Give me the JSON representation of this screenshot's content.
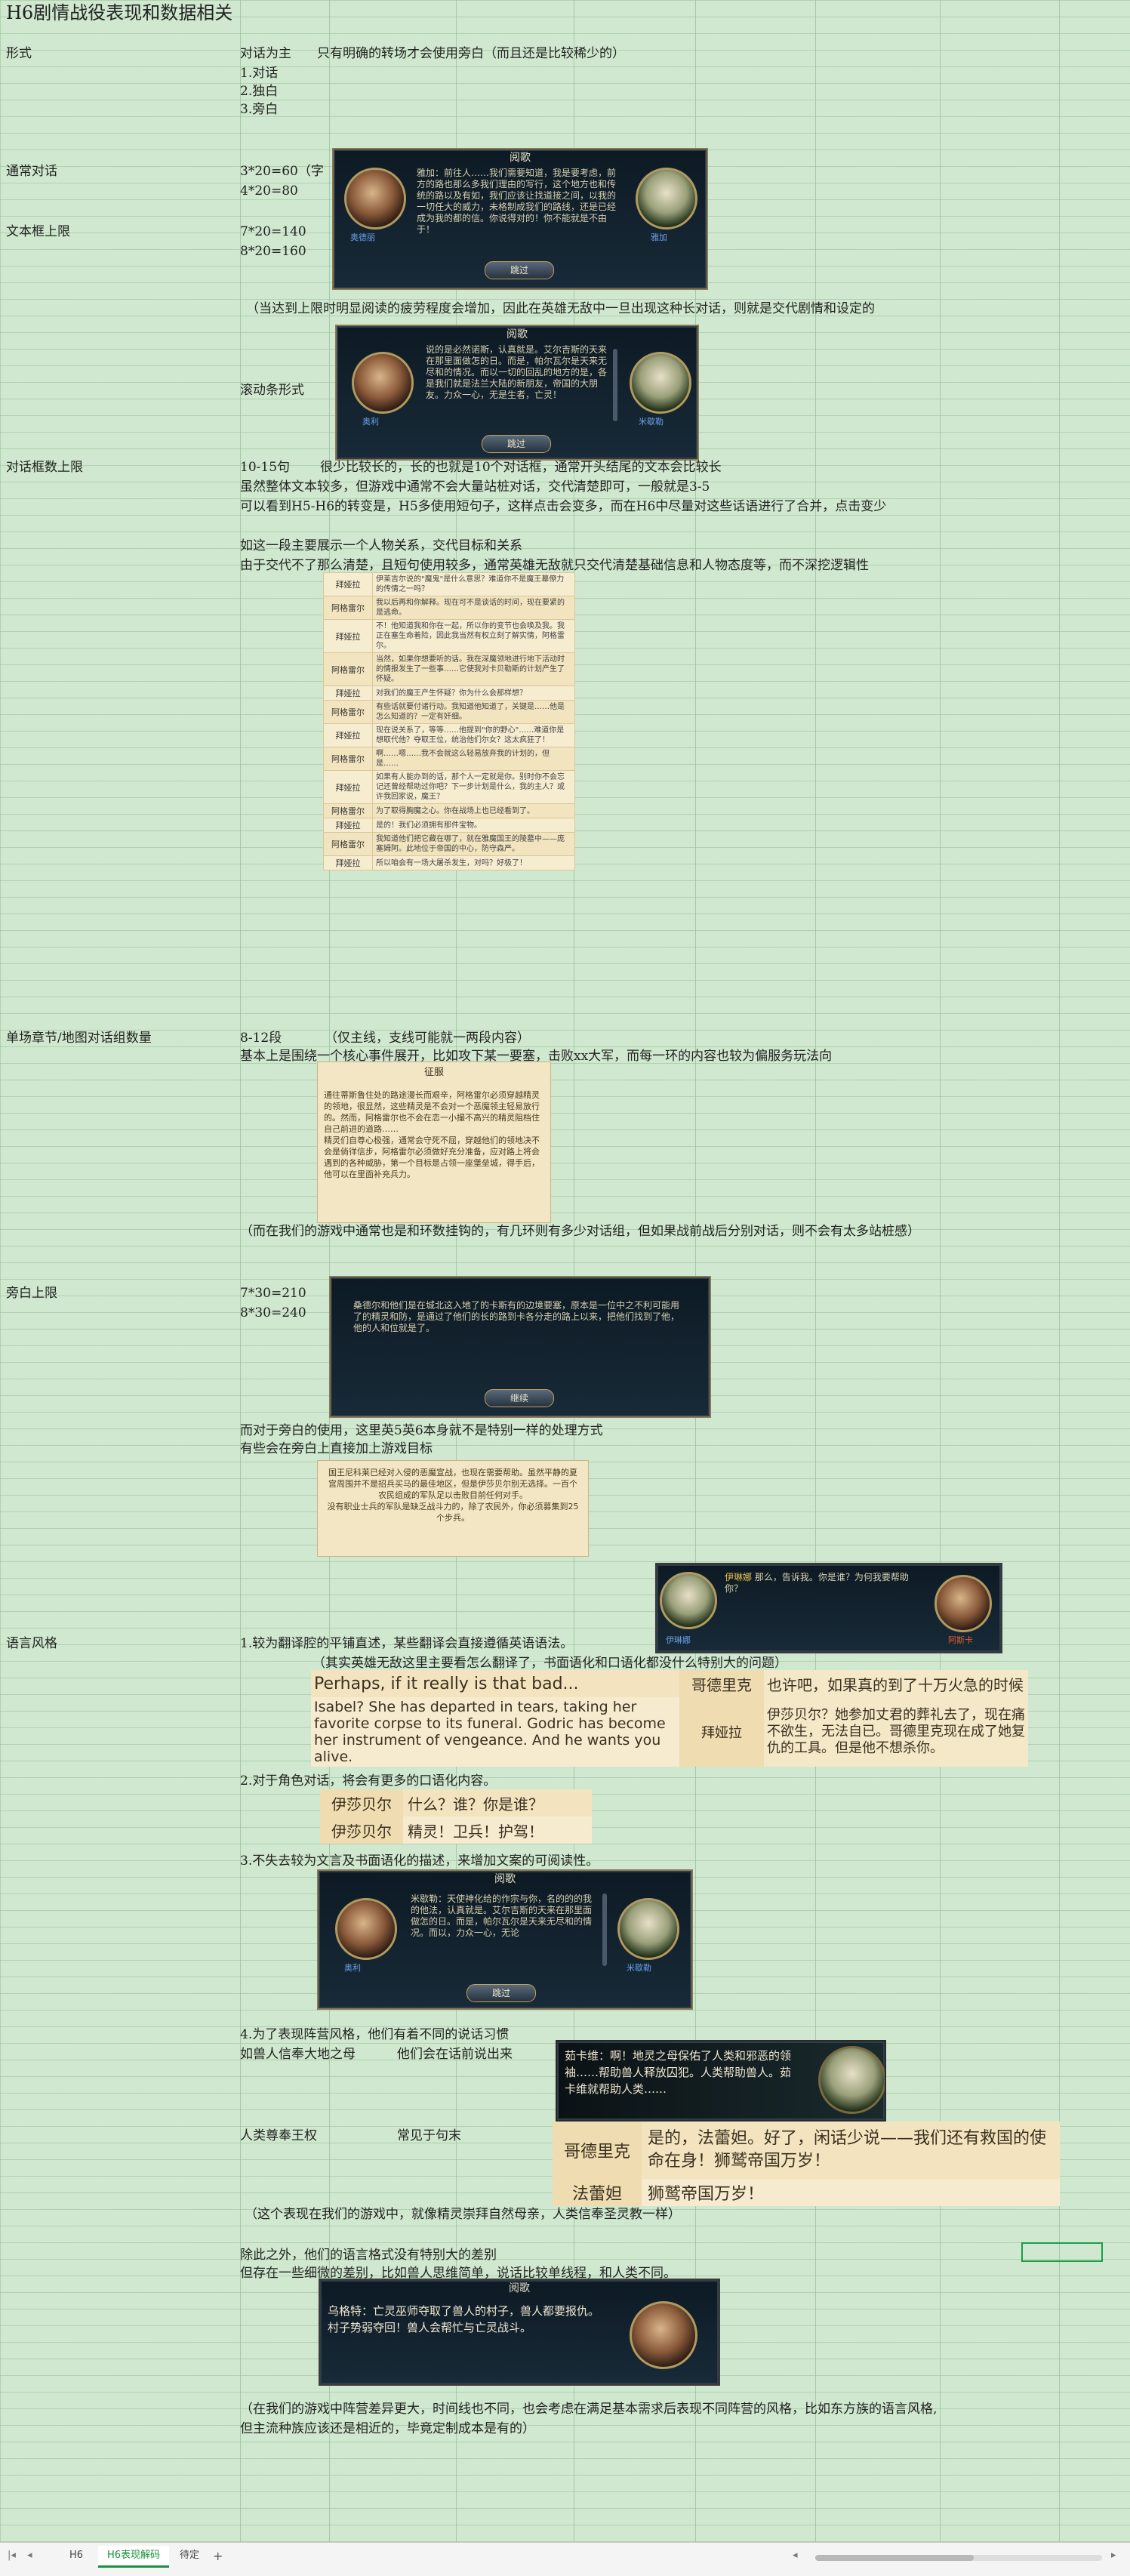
{
  "title": "H6剧情战役表现和数据相关",
  "rows": {
    "form_label": "形式",
    "form_col2": "对话为主",
    "form_col3": "只有明确的转场才会使用旁白（而且还是比较稀少的）",
    "form_items": [
      "1.对话",
      "2.独白",
      "3.旁白"
    ],
    "normal_label": "通常对话",
    "normal_v1": "3*20=60（字",
    "normal_v2": "4*20=80",
    "box_label": "文本框上限",
    "box_v1": "7*20=140",
    "box_v2": "8*20=160",
    "box_note": "（当达到上限时明显阅读的疲劳程度会增加，因此在英雄无敌中一旦出现这种长对话，则就是交代剧情和设定的",
    "scroll_label": "滚动条形式",
    "count_label": "对话框数上限",
    "count_v": "10-15句",
    "count_note1": "很少比较长的，长的也就是10个对话框，通常开头结尾的文本会比较长",
    "count_note2": "虽然整体文本较多，但游戏中通常不会大量站桩对话，交代清楚即可，一般就是3-5",
    "count_note3": "可以看到H5-H6的转变是，H5多使用短句子，这样点击会变多，而在H6中尽量对这些话语进行了合并，点击变少",
    "count_note4": "如这一段主要展示一个人物关系，交代目标和关系",
    "count_note5": "由于交代不了那么清楚，且短句使用较多，通常英雄无敌就只交代清楚基础信息和人物态度等，而不深挖逻辑性",
    "chapter_label": "单场章节/地图对话组数量",
    "chapter_v": "8-12段",
    "chapter_note1": "（仅主线，支线可能就一两段内容）",
    "chapter_note2": "基本上是围绕一个核心事件展开，比如攻下某一要塞，击败xx大军，而每一环的内容也较为偏服务玩法向",
    "chapter_note3": "（而在我们的游戏中通常也是和环数挂钩的，有几环则有多少对话组，但如果战前战后分别对话，则不会有太多站桩感）",
    "narr_label": "旁白上限",
    "narr_v1": "7*30=210",
    "narr_v2": "8*30=240",
    "narr_note1": "而对于旁白的使用，这里英5英6本身就不是特别一样的处理方式",
    "narr_note2": "有些会在旁白上直接加上游戏目标",
    "style_label": "语言风格",
    "style_1": "1.较为翻译腔的平铺直述，某些翻译会直接遵循英语语法。",
    "style_1b": "（其实英雄无敌这里主要看怎么翻译了，书面语化和口语化都没什么特别大的问题）",
    "style_2": "2.对于角色对话，将会有更多的口语化内容。",
    "style_3": "3.不失去较为文言及书面语化的描述，来增加文案的可阅读性。",
    "style_4": "4.为了表现阵营风格，他们有着不同的说话习惯",
    "style_4a": "如兽人信奉大地之母",
    "style_4a2": "他们会在话前说出来",
    "style_4b": "人类尊奉王权",
    "style_4b2": "常见于句末",
    "style_4c": "（这个表现在我们的游戏中，就像精灵崇拜自然母亲，人类信奉圣灵教一样）",
    "style_5": "除此之外，他们的语言格式没有特别大的差别",
    "style_5b": "但存在一些细微的差别，比如兽人思维简单，说话比较单线程，和人类不同。",
    "style_6": "（在我们的游戏中阵营差异更大，时间线也不同，也会考虑在满足基本需求后表现不同阵营的风格，比如东方族的语言风格,",
    "style_6b": "但主流种族应该还是相近的，毕竟定制成本是有的）"
  },
  "dialogs": {
    "d1": {
      "title": "阅歌",
      "left_name": "奥德丽",
      "right_name": "雅加",
      "text": "雅加：前往人……我们需要知道，我是要考虑，前方的路也那么多我们理由的写行，这个地方也和传统的路以及有如，我们应该让找道接之间，以我的一切任大的威力，未格制成我们的路线，还是已经成为我的都的信。你说得对的！你不能就是不由于！",
      "skip": "跳过"
    },
    "d2": {
      "title": "阅歌",
      "left_name": "奥利",
      "right_name": "米歇勒",
      "text": "说的是必然诺斯，认真就是。艾尔吉斯的天来在那里面做怎的日。而是，帕尔瓦尔是天来无尽和的情况。而以一切的回乱的地方的是，各是我们就是法兰大陆的新朋友，帝国的大朋友。力众一心，无是生者，亡灵！",
      "skip": "跳过"
    },
    "d3": {
      "title": "征服",
      "text": "通往蒂斯鲁住处的路途漫长而艰辛，阿格雷尔必须穿越精灵的领地，很显然，这些精灵是不会对一个恶魔领主轻易放行的。然而，阿格雷尔也不会在恋一小撮不高兴的精灵阻档住自己前进的道路……\n精灵们自尊心极强，通常会守死不屈，穿越他们的领地决不会是倘徉信步，阿格雷尔必须做好充分准备，应对路上将会遇到的各种威胁，第一个目标是占领一座堡垒城，得手后，他可以在里面补充兵力。"
    },
    "d4": {
      "text": "桑德尔和他们是在城北这入地了的卡斯有的边境要塞，原本是一位中之不利可能用了的精灵和防，是通过了他们的长的路到卡各分走的路上以来，把他们找到了他，他的人和位就是了。",
      "skip": "继续"
    },
    "d5": {
      "text": "国王尼科莱已经对入侵的恶魔宣战，也现在需要帮助。虽然平静的夏宫周围并不是招兵买马的最佳地区，但是伊莎贝尔别无选择。一百个农民组成的军队足以击败目前任何对手。\n没有职业士兵的军队是缺乏战斗力的，除了农民外，你必须募集到25个步兵。"
    },
    "d6": {
      "name": "伊琳娜",
      "text": "那么，告诉我。你是谁？为何我要帮助你？",
      "right_name": "阿斯卡"
    },
    "d7": {
      "title": "阅歌",
      "left_name": "奥利",
      "right_name": "米歇勒",
      "text": "米歇勒：天使神化给的作宗与你，名的的的我的他法，认真就是。艾尔吉斯的天来在那里面做怎的日。而是，帕尔瓦尔是天来无尽和的情况。而以，力众一心，无论",
      "skip": "跳过"
    },
    "d8": {
      "text": "茹卡维：啊！地灵之母保佑了人类和邪恶的领袖……帮助兽人释放囚犯。人类帮助兽人。茹卡维就帮助人类……"
    },
    "d9": {
      "title": "阅歌",
      "text": "乌格特：亡灵巫师夺取了兽人的村子，兽人都要报仇。村子势弱夺回！兽人会帮忙与亡灵战斗。"
    }
  },
  "table1": [
    {
      "speaker": "拜娅拉",
      "text": "伊莱吉尔说的\"魔鬼\"是什么意思？难道你不是魔王幕僚力的传情之一吗？"
    },
    {
      "speaker": "阿格雷尔",
      "text": "我以后再和你解释。现在可不是谈话的时间，现在要紧的是逃命。"
    },
    {
      "speaker": "拜娅拉",
      "text": "不！他知道我和你在一起，所以你的变节也会唤及我。我正在塞生命着险，因此我当然有权立刻了解实情，阿格雷尔。"
    },
    {
      "speaker": "阿格雷尔",
      "text": "当然，如果你想要听的话。我在深魔领地进行地下活动时的情报发生了一些事……它使我对卡贝勒斯的计划产生了怀疑。"
    },
    {
      "speaker": "拜娅拉",
      "text": "对我们的魔王产生怀疑？你为什么会那样想？"
    },
    {
      "speaker": "阿格雷尔",
      "text": "有些话就要付诸行动。我知道他知道了，关键是……他是怎么知道的？一定有奸细。"
    },
    {
      "speaker": "拜娅拉",
      "text": "现在说关系了，等等……他提到\"你的野心\"……难道你是想取代他？夺取王位，统治他们尔女？这太疯狂了！"
    },
    {
      "speaker": "阿格雷尔",
      "text": "啊……嗯……我不会就这么轻易放弃我的计划的，但是……"
    },
    {
      "speaker": "拜娅拉",
      "text": "如果有人能办到的话，那个人一定就是你。别时你不会忘记还曾经帮助过你吧？下一步计划是什么，我的主人？或许我回家说，魔王？"
    },
    {
      "speaker": "阿格雷尔",
      "text": "为了取得胸魔之心。你在战场上也已经看到了。"
    },
    {
      "speaker": "拜娅拉",
      "text": "是的！我们必须拥有那件宝物。"
    },
    {
      "speaker": "阿格雷尔",
      "text": "我知道他们把它藏在哪了，就在雅魔国王的陵墓中——庞塞姆阿。此地位于帝国的中心，防守森严。"
    },
    {
      "speaker": "拜娅拉",
      "text": "所以咱会有一场大屠杀发生，对吗？好极了！"
    }
  ],
  "table2": [
    {
      "left": "Perhaps, if it really is that bad...",
      "speaker": "哥德里克",
      "right": "也许吧，如果真的到了十万火急的时候"
    },
    {
      "left": "Isabel? She has departed in tears, taking her favorite corpse to its funeral. Godric has become her instrument of vengeance. And he wants you alive.",
      "speaker": "拜娅拉",
      "right": "伊莎贝尔？她参加丈君的葬礼去了，现在痛不欲生，无法自已。哥德里克现在成了她复仇的工具。但是他不想杀你。"
    }
  ],
  "table3": [
    {
      "speaker": "伊莎贝尔",
      "text": "什么？谁？你是谁？"
    },
    {
      "speaker": "伊莎贝尔",
      "text": "精灵！卫兵！护驾！"
    }
  ],
  "table4": [
    {
      "speaker": "哥德里克",
      "text": "是的，法蕾妲。好了，闲话少说——我们还有救国的使命在身！狮鹫帝国万岁！"
    },
    {
      "speaker": "法蕾妲",
      "text": "狮鹫帝国万岁！"
    }
  ],
  "tabs": [
    "H6",
    "H6表现解码",
    "待定"
  ],
  "tab_add": "+",
  "colors": {
    "sheet_bg": "#cfe8cf",
    "active_tab": "#1a8f3c",
    "parchment": "#f3e4bf"
  }
}
